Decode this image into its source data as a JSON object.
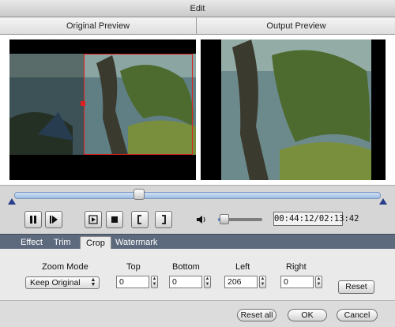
{
  "window": {
    "title": "Edit"
  },
  "preview": {
    "original_label": "Original Preview",
    "output_label": "Output Preview"
  },
  "playback": {
    "position_fraction": 0.34,
    "volume_fraction": 0.1,
    "time_display": "00:44:12/02:13:42"
  },
  "tabs": [
    {
      "label": "Effect",
      "active": false
    },
    {
      "label": "Trim",
      "active": false
    },
    {
      "label": "Crop",
      "active": true
    },
    {
      "label": "Watermark",
      "active": false
    }
  ],
  "crop": {
    "zoom_mode_label": "Zoom Mode",
    "zoom_mode_value": "Keep Original",
    "top_label": "Top",
    "top_value": "0",
    "bottom_label": "Bottom",
    "bottom_value": "0",
    "left_label": "Left",
    "left_value": "206",
    "right_label": "Right",
    "right_value": "0",
    "reset_label": "Reset"
  },
  "footer": {
    "reset_all_label": "Reset all",
    "ok_label": "OK",
    "cancel_label": "Cancel"
  },
  "colors": {
    "crop_border": "#e0201e",
    "tabbar": "#5d6a7e",
    "track": "#9fbde2"
  }
}
